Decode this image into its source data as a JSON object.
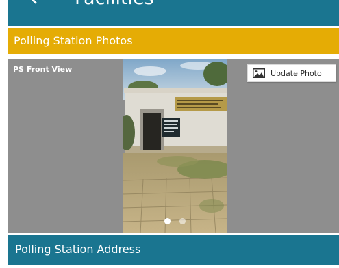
{
  "app_bar": {
    "title": "Facilities",
    "back_icon": "arrow-left-icon"
  },
  "sections": {
    "photos_header": "Polling Station Photos",
    "address_header": "Polling Station Address"
  },
  "photo_panel": {
    "label": "PS Front View",
    "update_button": {
      "label": "Update Photo",
      "icon": "image-icon"
    },
    "carousel": {
      "total": 2,
      "active_index": 0
    }
  },
  "colors": {
    "primary": "#1a7590",
    "accent": "#e5ac05",
    "panel_bg": "#8e8e8e"
  }
}
